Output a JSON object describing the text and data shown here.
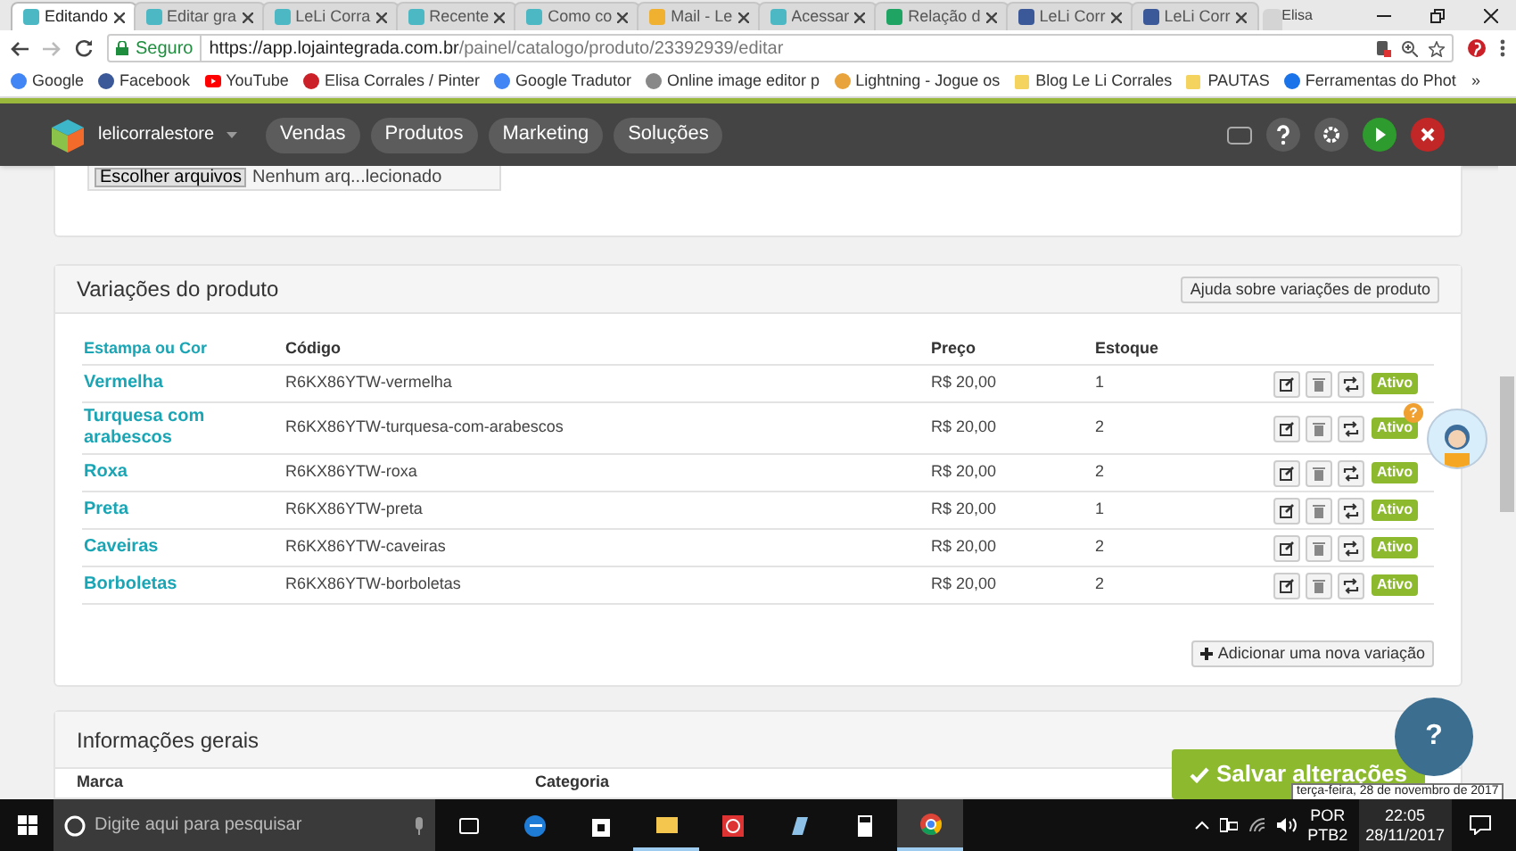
{
  "browser": {
    "tabs": [
      {
        "label": "Editando",
        "selected": true
      },
      {
        "label": "Editar gra",
        "selected": false
      },
      {
        "label": "LeLi Corra",
        "selected": false
      },
      {
        "label": "Recente",
        "selected": false
      },
      {
        "label": "Como co",
        "selected": false
      },
      {
        "label": "Mail - Le",
        "selected": false
      },
      {
        "label": "Acessar",
        "selected": false
      },
      {
        "label": "Relação d",
        "selected": false
      },
      {
        "label": "LeLi Corr",
        "selected": false
      },
      {
        "label": "LeLi Corr",
        "selected": false
      }
    ],
    "user": "Elisa",
    "secure_label": "Seguro",
    "url_host": "https://app.lojaintegrada.com.br",
    "url_path": "/painel/catalogo/produto/23392939/editar",
    "bookmarks": [
      "Google",
      "Facebook",
      "YouTube",
      "Elisa Corrales / Pinter",
      "Google Tradutor",
      "Online image editor p",
      "Lightning - Jogue os",
      "Blog Le Li Corrales",
      "PAUTAS",
      "Ferramentas do Phot"
    ],
    "more": "»"
  },
  "store_nav": {
    "store": "lelicorralestore",
    "menu": [
      "Vendas",
      "Produtos",
      "Marketing",
      "Soluções"
    ]
  },
  "file_upload": {
    "button": "Escolher arquivos",
    "status": "Nenhum arq...lecionado"
  },
  "variations": {
    "title": "Variações do produto",
    "help_button": "Ajuda sobre variações de produto",
    "columns": [
      "Estampa ou Cor",
      "Código",
      "Preço",
      "Estoque"
    ],
    "rows": [
      {
        "name": "Vermelha",
        "code": "R6KX86YTW-vermelha",
        "price": "R$ 20,00",
        "stock": "1",
        "status": "Ativo"
      },
      {
        "name": "Turquesa com arabescos",
        "code": "R6KX86YTW-turquesa-com-arabescos",
        "price": "R$ 20,00",
        "stock": "2",
        "status": "Ativo"
      },
      {
        "name": "Roxa",
        "code": "R6KX86YTW-roxa",
        "price": "R$ 20,00",
        "stock": "2",
        "status": "Ativo"
      },
      {
        "name": "Preta",
        "code": "R6KX86YTW-preta",
        "price": "R$ 20,00",
        "stock": "1",
        "status": "Ativo"
      },
      {
        "name": "Caveiras",
        "code": "R6KX86YTW-caveiras",
        "price": "R$ 20,00",
        "stock": "2",
        "status": "Ativo"
      },
      {
        "name": "Borboletas",
        "code": "R6KX86YTW-borboletas",
        "price": "R$ 20,00",
        "stock": "2",
        "status": "Ativo"
      }
    ],
    "add_button": "Adicionar uma nova variação"
  },
  "general_info": {
    "title": "Informações gerais",
    "fields": [
      "Marca",
      "Categoria"
    ]
  },
  "save_button": "Salvar alterações",
  "help_badge": "?",
  "avatar_badge": "?",
  "tooltip": "terça-feira, 28 de novembro de 2017",
  "taskbar": {
    "search_placeholder": "Digite aqui para pesquisar",
    "lang": "POR",
    "layout": "PTB2",
    "time": "22:05",
    "date": "28/11/2017"
  }
}
